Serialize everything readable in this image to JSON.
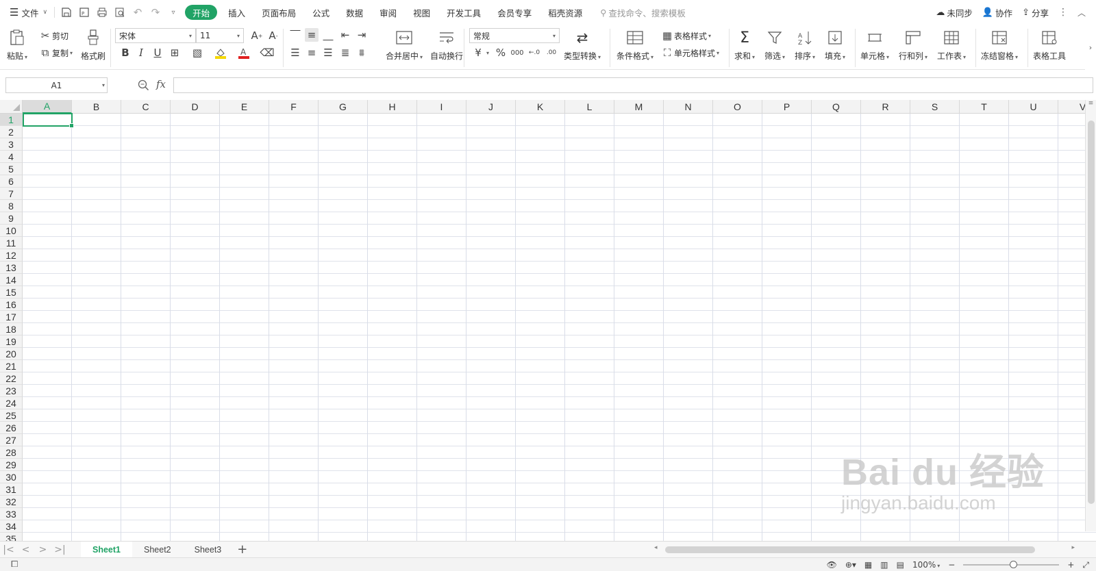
{
  "menubar": {
    "file_label": "文件",
    "tabs": [
      "开始",
      "插入",
      "页面布局",
      "公式",
      "数据",
      "审阅",
      "视图",
      "开发工具",
      "会员专享",
      "稻壳资源"
    ],
    "active_tab": "开始",
    "search_placeholder": "查找命令、搜索模板",
    "sync_label": "未同步",
    "collab_label": "协作",
    "share_label": "分享"
  },
  "ribbon": {
    "paste": "粘贴",
    "cut": "剪切",
    "copy": "复制",
    "format_painter": "格式刷",
    "font_name": "宋体",
    "font_size": "11",
    "merge_center": "合并居中",
    "wrap_text": "自动换行",
    "number_format": "常规",
    "type_convert": "类型转换",
    "conditional_format": "条件格式",
    "table_style": "表格样式",
    "cell_style": "单元格样式",
    "sum": "求和",
    "filter": "筛选",
    "sort": "排序",
    "fill": "填充",
    "cell": "单元格",
    "row_col": "行和列",
    "worksheet": "工作表",
    "freeze": "冻结窗格",
    "table_tools": "表格工具",
    "currency_symbol": "¥",
    "percent_symbol": "%",
    "thousands_symbol": "000"
  },
  "formula_bar": {
    "name_box": "A1",
    "fx_label": "fx",
    "formula_value": ""
  },
  "grid": {
    "columns": [
      "A",
      "B",
      "C",
      "D",
      "E",
      "F",
      "G",
      "H",
      "I",
      "J",
      "K",
      "L",
      "M",
      "N",
      "O",
      "P",
      "Q",
      "R",
      "S",
      "T",
      "U",
      "V"
    ],
    "rows": [
      "1",
      "2",
      "3",
      "4",
      "5",
      "6",
      "7",
      "8",
      "9",
      "10",
      "11",
      "12",
      "13",
      "14",
      "15",
      "16",
      "17",
      "18",
      "19",
      "20",
      "21",
      "22",
      "23",
      "24",
      "25",
      "26",
      "27",
      "28",
      "29",
      "30",
      "31",
      "32",
      "33",
      "34",
      "35"
    ],
    "active_cell": "A1"
  },
  "sheets": [
    "Sheet1",
    "Sheet2",
    "Sheet3"
  ],
  "active_sheet": "Sheet1",
  "statusbar": {
    "zoom": "100%"
  },
  "watermark": {
    "logo": "Bai du 经验",
    "url": "jingyan.baidu.com"
  },
  "colors": {
    "accent": "#21a366",
    "font_color_bar": "#e02020",
    "fill_color_bar": "#f5d800"
  }
}
